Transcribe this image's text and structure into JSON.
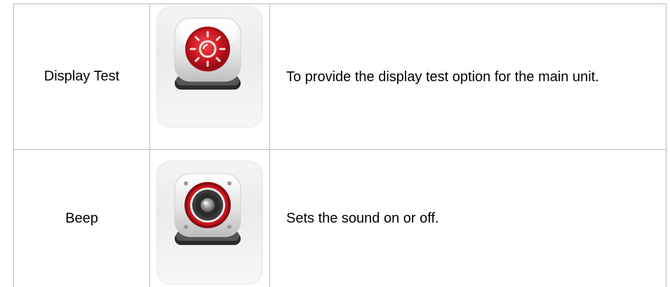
{
  "rows": [
    {
      "name": "Display Test",
      "icon": "display-test-icon",
      "description": "To provide the display test option for the main unit."
    },
    {
      "name": "Beep",
      "icon": "speaker-icon",
      "description": "Sets the sound on or off."
    }
  ],
  "colors": {
    "icon_red": "#c8141e",
    "border": "#bdbdbd"
  }
}
